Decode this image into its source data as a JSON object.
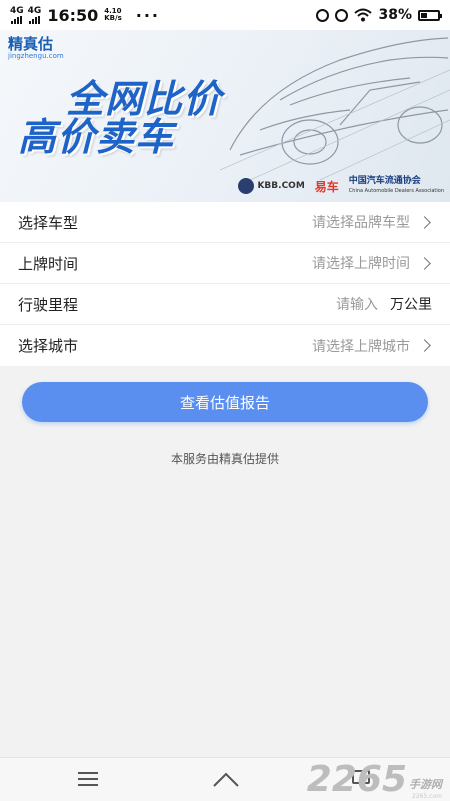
{
  "status_bar": {
    "network_1": "4G",
    "network_2": "4G",
    "time": "16:50",
    "speed_value": "4.10",
    "speed_unit": "KB/s",
    "more": "···",
    "battery": "38%",
    "battery_level": 0.38
  },
  "banner": {
    "logo_name": "精真估",
    "logo_url": "jingzhengu.com",
    "slogan_line1": "全网比价",
    "slogan_line2": "高价卖车",
    "partner_kbb": "KBB.COM",
    "partner_yiche": "易车",
    "partner_assoc": "中国汽车流通协会",
    "partner_assoc_en": "China Automobile Dealers Association"
  },
  "form": {
    "rows": [
      {
        "label": "选择车型",
        "value": "请选择品牌车型"
      },
      {
        "label": "上牌时间",
        "value": "请选择上牌时间"
      },
      {
        "label": "行驶里程",
        "placeholder": "请输入",
        "unit": "万公里"
      },
      {
        "label": "选择城市",
        "value": "请选择上牌城市"
      }
    ]
  },
  "submit_label": "查看估值报告",
  "provider_note": "本服务由精真估提供",
  "watermark": {
    "number": "2265",
    "text": "手游网",
    "url": "2265.com"
  },
  "colors": {
    "accent": "#5a8ff0",
    "brand": "#1e63c7"
  }
}
